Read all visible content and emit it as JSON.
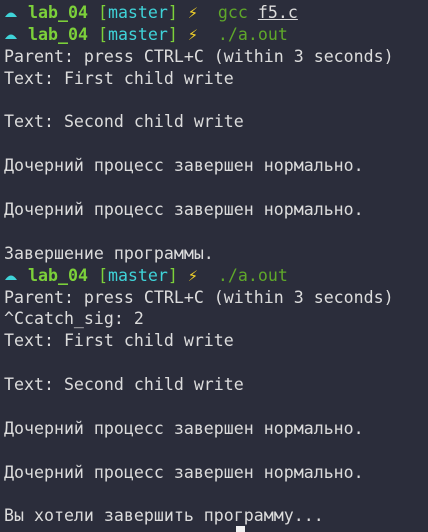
{
  "colors": {
    "background": "#2b2d3b",
    "text": "#dcdcdc",
    "prompt_dir": "#7cd03a",
    "prompt_branch": "#3fd3d8",
    "bolt": "#f2d22a",
    "command": "#5fa82a"
  },
  "prompt_icons": {
    "triangle": "triangle-up-icon",
    "bolt": "lightning-bolt-icon"
  },
  "lines": [
    {
      "type": "prompt",
      "triangle": "☁",
      "dir": "lab_04",
      "branch": "master",
      "bolt": "⚡",
      "cmd": "gcc",
      "arg": "f5.c"
    },
    {
      "type": "prompt",
      "triangle": "☁",
      "dir": "lab_04",
      "branch": "master",
      "bolt": "⚡",
      "cmd": "./a.out",
      "arg": ""
    },
    {
      "type": "text",
      "text": "Parent: press CTRL+C (within 3 seconds)"
    },
    {
      "type": "text",
      "text": "Text: First child write"
    },
    {
      "type": "text",
      "text": ""
    },
    {
      "type": "text",
      "text": "Text: Second child write"
    },
    {
      "type": "text",
      "text": ""
    },
    {
      "type": "text",
      "text": "Дочерний процесс завершен нормально."
    },
    {
      "type": "text",
      "text": ""
    },
    {
      "type": "text",
      "text": "Дочерний процесс завершен нормально."
    },
    {
      "type": "text",
      "text": ""
    },
    {
      "type": "text",
      "text": "Завершение программы."
    },
    {
      "type": "prompt",
      "triangle": "☁",
      "dir": "lab_04",
      "branch": "master",
      "bolt": "⚡",
      "cmd": "./a.out",
      "arg": ""
    },
    {
      "type": "text",
      "text": "Parent: press CTRL+C (within 3 seconds)"
    },
    {
      "type": "text",
      "text": "^Ccatch_sig: 2"
    },
    {
      "type": "text",
      "text": "Text: First child write"
    },
    {
      "type": "text",
      "text": ""
    },
    {
      "type": "text",
      "text": "Text: Second child write"
    },
    {
      "type": "text",
      "text": ""
    },
    {
      "type": "text",
      "text": "Дочерний процесс завершен нормально."
    },
    {
      "type": "text",
      "text": ""
    },
    {
      "type": "text",
      "text": "Дочерний процесс завершен нормально."
    },
    {
      "type": "text",
      "text": ""
    },
    {
      "type": "text",
      "text": "Вы хотели завершить программу..."
    }
  ]
}
